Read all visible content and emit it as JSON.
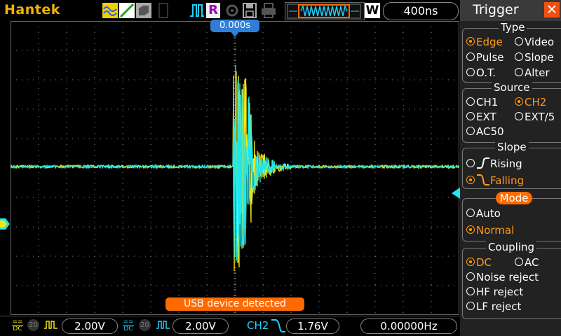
{
  "topbar": {
    "brand": "Hantek",
    "run_mode_icon": "R",
    "timebase": "400ns",
    "waveform_icon": "W"
  },
  "screen": {
    "trigger_position": "0.000s",
    "message": "USB device detected",
    "colors": {
      "ch1": "#f5e70f",
      "ch2": "#20e6ee",
      "grid": "#888888",
      "accent": "#ff6a00",
      "marker": "#2f7fd6"
    }
  },
  "bottom": {
    "ch1_coupling": "DC",
    "ch1_probe": "20",
    "ch1_volts": "2.00V",
    "ch2_coupling": "DC",
    "ch2_probe": "20",
    "ch2_volts": "2.00V",
    "trigger_source": "CH2",
    "trigger_level": "1.76V",
    "frequency": "0.00000Hz"
  },
  "panel": {
    "title": "Trigger",
    "type": {
      "heading": "Type",
      "options": [
        "Edge",
        "Video",
        "Pulse",
        "Slope",
        "O.T.",
        "Alter"
      ],
      "selected": "Edge"
    },
    "source": {
      "heading": "Source",
      "options": [
        "CH1",
        "CH2",
        "EXT",
        "EXT/5",
        "AC50"
      ],
      "selected": "CH2"
    },
    "slope": {
      "heading": "Slope",
      "options": [
        "Rising",
        "Falling"
      ],
      "selected": "Falling"
    },
    "mode": {
      "heading": "Mode",
      "options": [
        "Auto",
        "Normal"
      ],
      "selected": "Normal"
    },
    "coupling": {
      "heading": "Coupling",
      "options": [
        "DC",
        "AC",
        "Noise reject",
        "HF reject",
        "LF reject"
      ],
      "selected": "DC"
    }
  }
}
